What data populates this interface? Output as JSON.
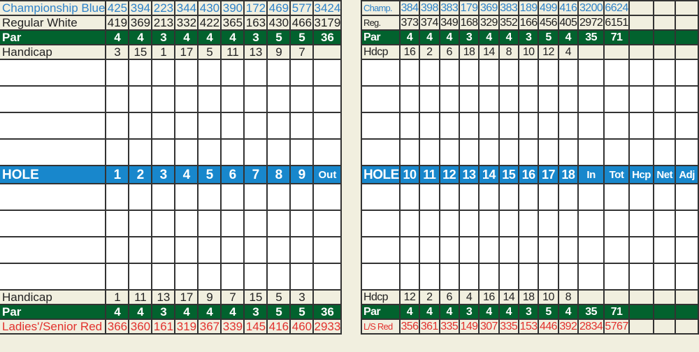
{
  "front_nine": {
    "championship_blue": {
      "label": "Championship Blue",
      "values": [
        "425",
        "394",
        "223",
        "344",
        "430",
        "390",
        "172",
        "469",
        "577",
        "3424"
      ]
    },
    "regular_white": {
      "label": "Regular White",
      "values": [
        "419",
        "369",
        "213",
        "332",
        "422",
        "365",
        "163",
        "430",
        "466",
        "3179"
      ]
    },
    "par_top": {
      "label": "Par",
      "values": [
        "4",
        "4",
        "3",
        "4",
        "4",
        "4",
        "3",
        "5",
        "5",
        "36"
      ]
    },
    "handicap_top": {
      "label": "Handicap",
      "values": [
        "3",
        "15",
        "1",
        "17",
        "5",
        "11",
        "13",
        "9",
        "7",
        ""
      ]
    },
    "hole": {
      "label": "HOLE",
      "values": [
        "1",
        "2",
        "3",
        "4",
        "5",
        "6",
        "7",
        "8",
        "9",
        "Out"
      ]
    },
    "handicap_bottom": {
      "label": "Handicap",
      "values": [
        "1",
        "11",
        "13",
        "17",
        "9",
        "7",
        "15",
        "5",
        "3",
        ""
      ]
    },
    "par_bottom": {
      "label": "Par",
      "values": [
        "4",
        "4",
        "3",
        "4",
        "4",
        "4",
        "3",
        "5",
        "5",
        "36"
      ]
    },
    "ladies_senior_red": {
      "label": "Ladies'/Senior Red",
      "values": [
        "366",
        "360",
        "161",
        "319",
        "367",
        "339",
        "145",
        "416",
        "460",
        "2933"
      ]
    }
  },
  "back_nine": {
    "championship_blue": {
      "label": "Champ.",
      "values": [
        "384",
        "398",
        "383",
        "179",
        "369",
        "383",
        "189",
        "499",
        "416",
        "3200",
        "6624",
        "",
        "",
        "",
        ""
      ]
    },
    "regular_white": {
      "label": "Reg.",
      "values": [
        "373",
        "374",
        "349",
        "168",
        "329",
        "352",
        "166",
        "456",
        "405",
        "2972",
        "6151",
        "",
        "",
        "",
        ""
      ]
    },
    "par_top": {
      "label": "Par",
      "values": [
        "4",
        "4",
        "4",
        "3",
        "4",
        "4",
        "3",
        "5",
        "4",
        "35",
        "71",
        "",
        "",
        "",
        ""
      ]
    },
    "handicap_top": {
      "label": "Hdcp",
      "values": [
        "16",
        "2",
        "6",
        "18",
        "14",
        "8",
        "10",
        "12",
        "4",
        "",
        "",
        "",
        "",
        "",
        ""
      ]
    },
    "hole": {
      "label": "HOLE",
      "values": [
        "10",
        "11",
        "12",
        "13",
        "14",
        "15",
        "16",
        "17",
        "18",
        "In",
        "Tot",
        "Hcp",
        "Net",
        "Adj"
      ]
    },
    "handicap_bottom": {
      "label": "Hdcp",
      "values": [
        "12",
        "2",
        "6",
        "4",
        "16",
        "14",
        "18",
        "10",
        "8",
        "",
        "",
        "",
        "",
        "",
        ""
      ]
    },
    "par_bottom": {
      "label": "Par",
      "values": [
        "4",
        "4",
        "4",
        "3",
        "4",
        "4",
        "3",
        "5",
        "4",
        "35",
        "71",
        "",
        "",
        "",
        ""
      ]
    },
    "ladies_senior_red": {
      "label": "L/S Red",
      "values": [
        "356",
        "361",
        "335",
        "149",
        "307",
        "335",
        "153",
        "446",
        "392",
        "2834",
        "5767",
        "",
        "",
        "",
        ""
      ]
    }
  },
  "colors": {
    "championship_blue": "#2f83c9",
    "par_green": "#02622e",
    "hole_blue": "#1887cc",
    "ladies_red": "#e2312d",
    "card_background": "#f1efdf"
  }
}
